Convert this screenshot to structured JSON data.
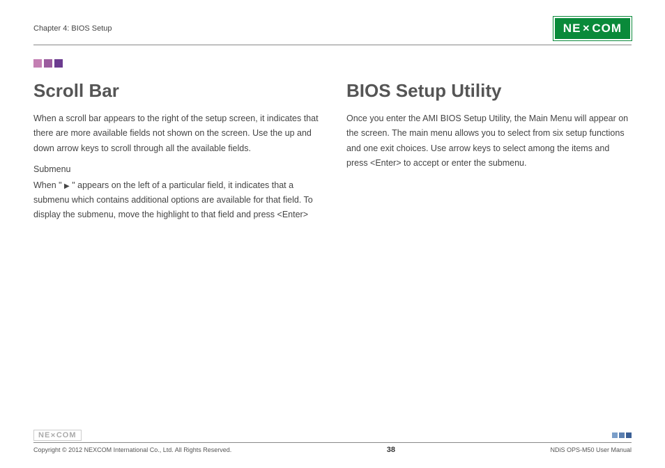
{
  "header": {
    "chapter": "Chapter 4: BIOS Setup",
    "logo_text": "NE COM"
  },
  "leftColumn": {
    "heading": "Scroll Bar",
    "para1": "When a scroll bar appears to the right of the setup screen, it indicates that there are more available fields not shown on the screen. Use the up and down arrow keys to scroll through all the available fields.",
    "subheading": "Submenu",
    "para2_before": "When \" ",
    "para2_after": " \" appears on the left of a particular field, it indicates that a submenu which contains additional options are available for that field. To display the submenu, move the highlight to that field and press <Enter>"
  },
  "rightColumn": {
    "heading": "BIOS Setup Utility",
    "para1": "Once you enter the AMI BIOS Setup Utility, the Main Menu will appear on the screen. The main menu allows you to select from six setup functions and one exit choices. Use arrow keys to select among the items and press <Enter> to accept or enter the submenu."
  },
  "footer": {
    "logo": "NE COM",
    "copyright": "Copyright © 2012 NEXCOM International Co., Ltd. All Rights Reserved.",
    "page": "38",
    "manual": "NDiS OPS-M50 User Manual"
  }
}
